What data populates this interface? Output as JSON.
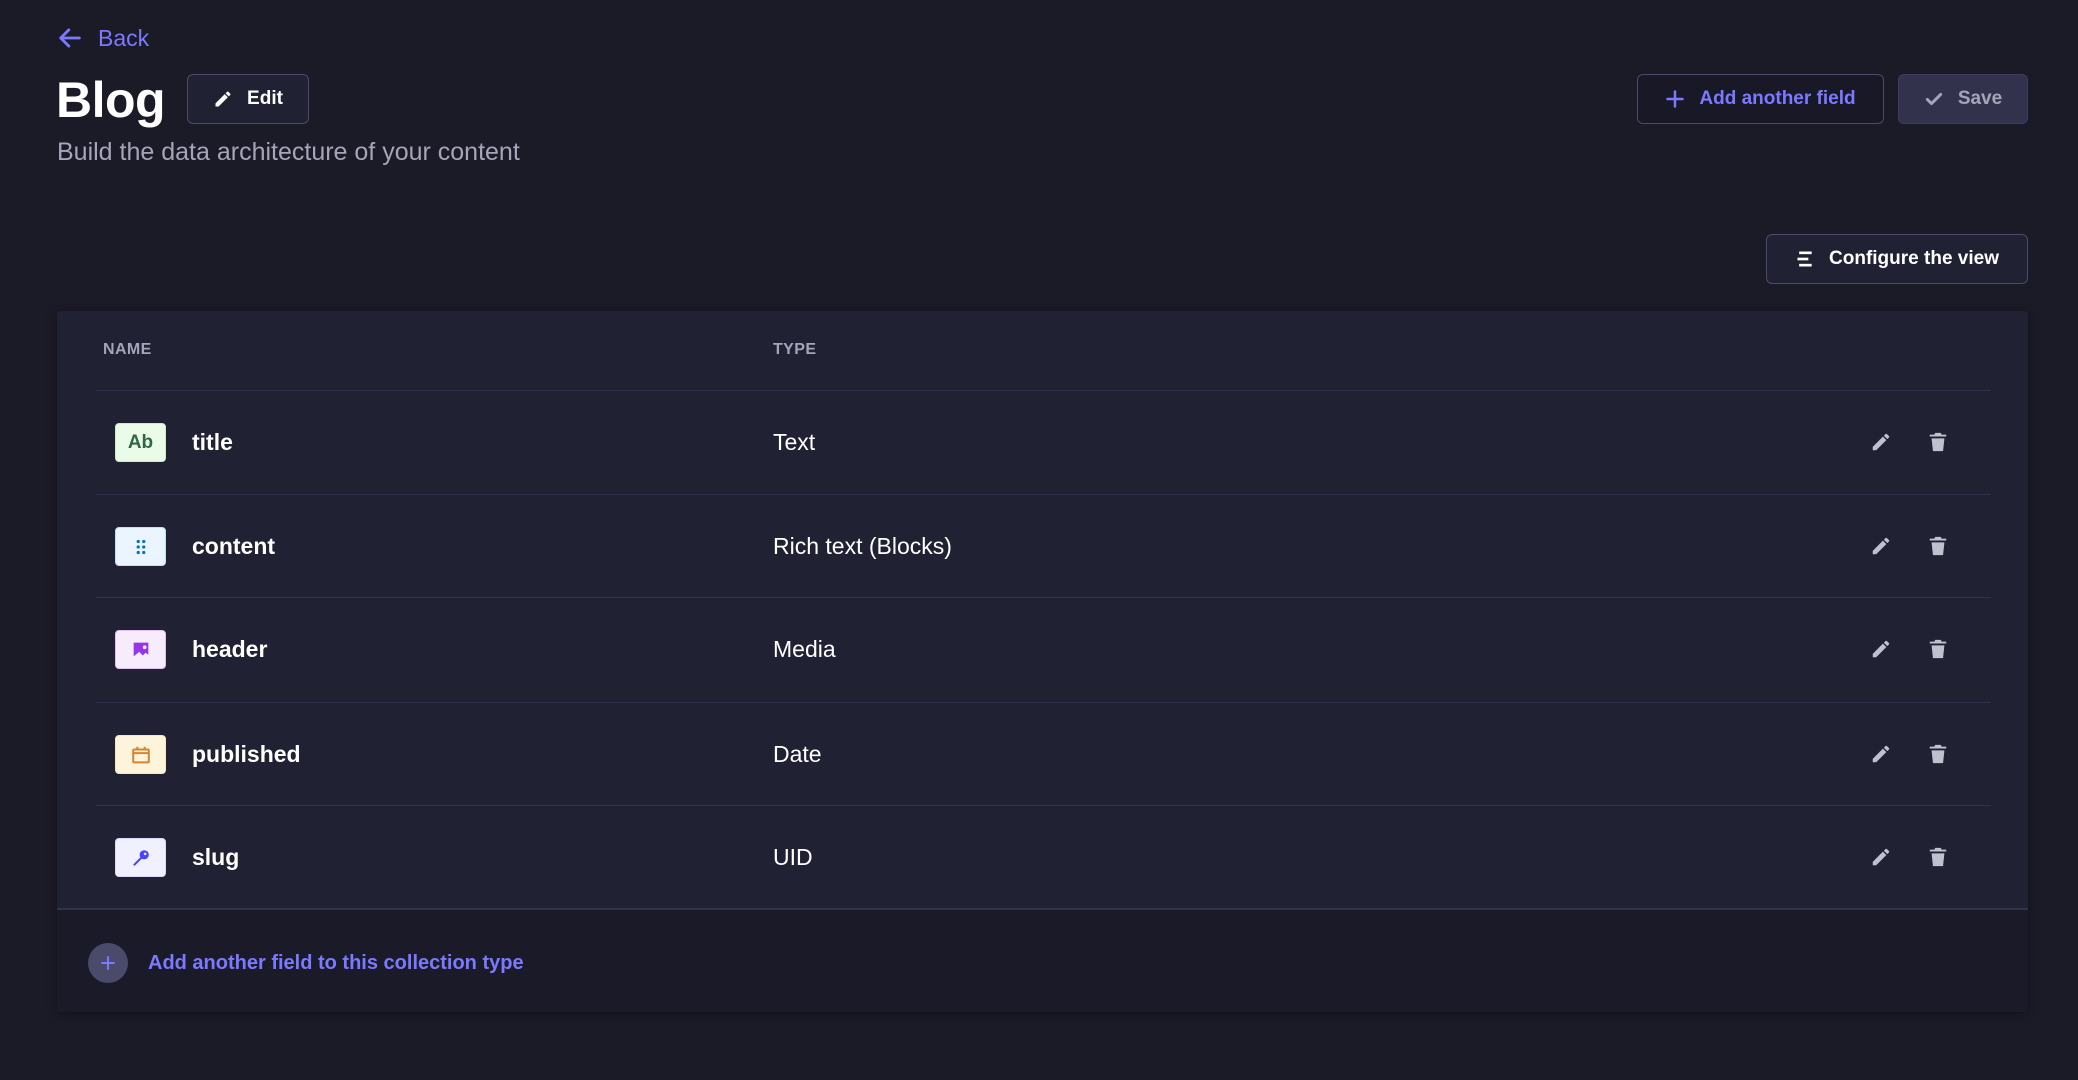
{
  "header": {
    "back_label": "Back",
    "title": "Blog",
    "edit_label": "Edit",
    "subtitle": "Build the data architecture of your content",
    "add_field_label": "Add another field",
    "save_label": "Save",
    "configure_label": "Configure the view"
  },
  "table": {
    "columns": {
      "name": "NAME",
      "type": "TYPE"
    },
    "rows": [
      {
        "name": "title",
        "type": "Text",
        "icon": "text-icon",
        "icon_text": "Ab",
        "icon_bg": "#eafbe7",
        "icon_color": "#2f6846"
      },
      {
        "name": "content",
        "type": "Rich text (Blocks)",
        "icon": "blocks-icon",
        "icon_bg": "#eaf5ff",
        "icon_color": "#0c75af"
      },
      {
        "name": "header",
        "type": "Media",
        "icon": "media-icon",
        "icon_bg": "#f6ecfc",
        "icon_color": "#9736e8"
      },
      {
        "name": "published",
        "type": "Date",
        "icon": "calendar-icon",
        "icon_bg": "#fdf4dc",
        "icon_color": "#d9822f"
      },
      {
        "name": "slug",
        "type": "UID",
        "icon": "key-icon",
        "icon_bg": "#f0f0ff",
        "icon_color": "#4945ff"
      }
    ]
  },
  "footer": {
    "add_label": "Add another field to this collection type"
  },
  "colors": {
    "accent": "#7b79ff",
    "background": "#1b1a27",
    "card": "#212134"
  }
}
